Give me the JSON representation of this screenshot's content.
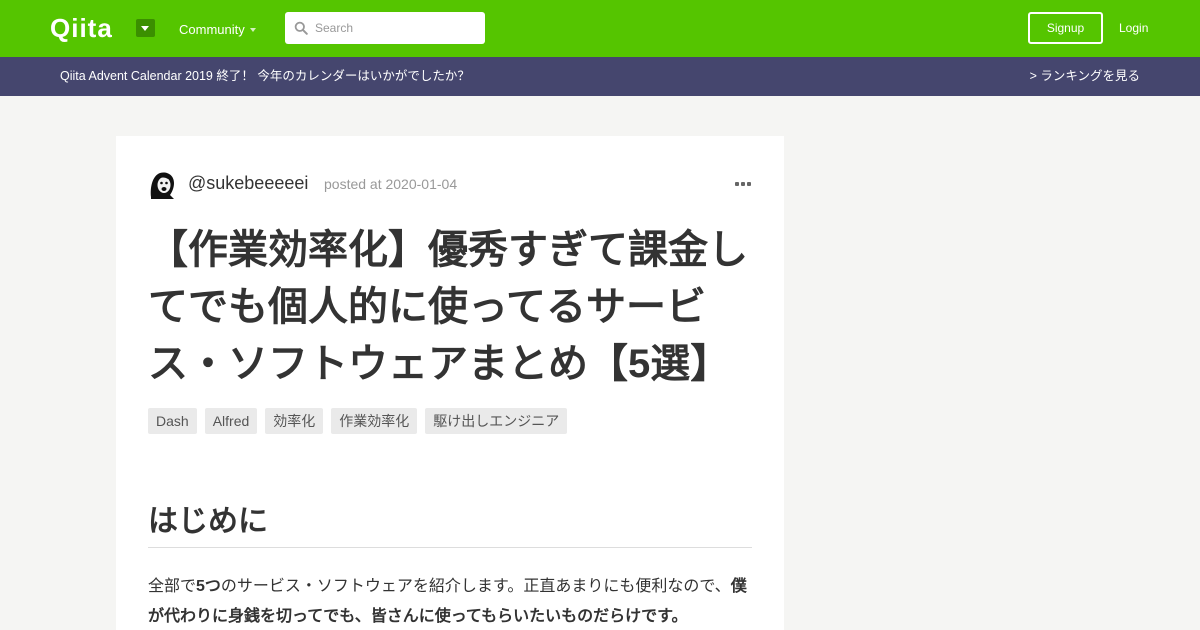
{
  "header": {
    "logo": "Qiita",
    "community_label": "Community",
    "search_placeholder": "Search",
    "signup_label": "Signup",
    "login_label": "Login"
  },
  "banner": {
    "text": "Qiita Advent Calendar 2019 終了！ 今年のカレンダーはいかがでしたか？",
    "link": "> ランキングを見る"
  },
  "article": {
    "author": "@sukebeeeeei",
    "posted": "posted at 2020-01-04",
    "title": "【作業効率化】優秀すぎて課金してでも個人的に使ってるサービス・ソフトウェアまとめ【5選】",
    "tags": [
      "Dash",
      "Alfred",
      "効率化",
      "作業効率化",
      "駆け出しエンジニア"
    ],
    "heading": "はじめに",
    "para": {
      "t1": "全部で",
      "b1": "5つ",
      "t2": "のサービス・ソフトウェアを紹介します。正直あまりにも便利なので、",
      "b2": "僕が代わりに身銭を切ってでも、皆さんに使ってもらいたいものだらけです。"
    }
  },
  "colors": {
    "brand": "#55c500",
    "banner": "#45466e",
    "background": "#f5f5f3"
  },
  "icons": {
    "logo_menu": "caret-down-icon",
    "search": "search-icon",
    "more": "more-horizontal-icon"
  }
}
